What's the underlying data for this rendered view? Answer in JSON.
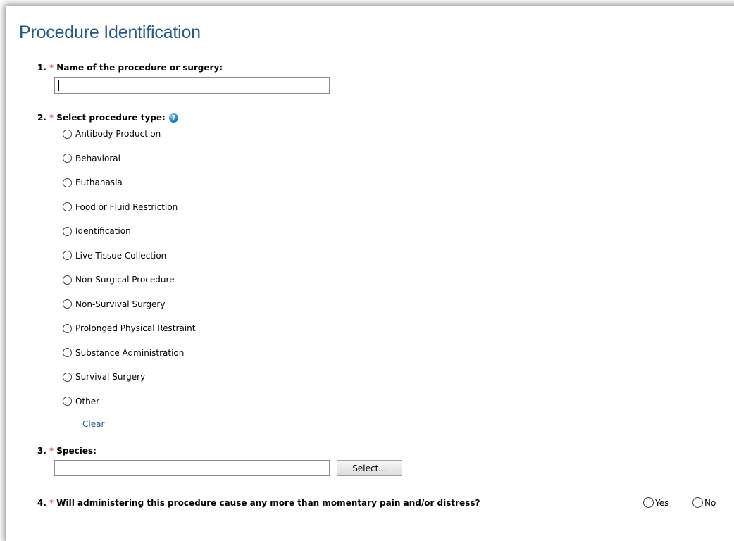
{
  "page_title": "Procedure Identification",
  "required_marker": "*",
  "q1": {
    "number": "1.",
    "label": "Name of the procedure or surgery:",
    "value": ""
  },
  "q2": {
    "number": "2.",
    "label": "Select procedure type:",
    "help_icon": "help-icon",
    "options": [
      "Antibody Production",
      "Behavioral",
      "Euthanasia",
      "Food or Fluid Restriction",
      "Identification",
      "Live Tissue Collection",
      "Non-Surgical Procedure",
      "Non-Survival Surgery",
      "Prolonged Physical Restraint",
      "Substance Administration",
      "Survival Surgery",
      "Other"
    ],
    "clear_label": "Clear"
  },
  "q3": {
    "number": "3.",
    "label": "Species:",
    "value": "",
    "select_button": "Select..."
  },
  "q4": {
    "number": "4.",
    "label": "Will administering this procedure cause any more than momentary pain and/or distress?",
    "options": [
      "Yes",
      "No"
    ]
  },
  "colors": {
    "title": "#215a8c",
    "required": "#d9302c",
    "link": "#1a5aa6"
  }
}
